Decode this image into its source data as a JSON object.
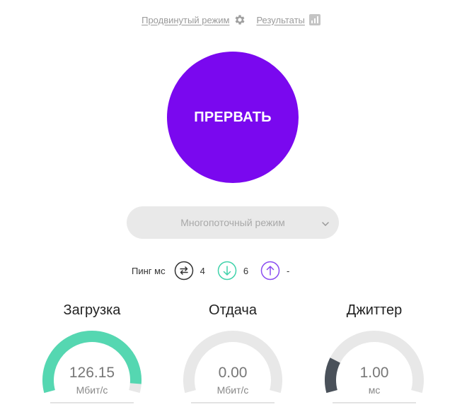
{
  "top_links": {
    "advanced_mode": "Продвинутый режим",
    "results": "Результаты"
  },
  "main_button": {
    "label": "ПРЕРВАТЬ",
    "color": "#7a08ef"
  },
  "mode_select": {
    "selected": "Многопоточный режим"
  },
  "ping": {
    "label": "Пинг мс",
    "items": [
      {
        "icon": "swap-arrows-icon",
        "value": "4",
        "color": "#333333"
      },
      {
        "icon": "arrow-down-circle-icon",
        "value": "6",
        "color": "#3fd2aa"
      },
      {
        "icon": "arrow-up-circle-icon",
        "value": "-",
        "color": "#8a4cf0"
      }
    ]
  },
  "gauges": [
    {
      "title": "Загрузка",
      "value": "126.15",
      "unit": "Мбит/с",
      "fill_fraction": 0.95,
      "color": "#55d7b1"
    },
    {
      "title": "Отдача",
      "value": "0.00",
      "unit": "Мбит/с",
      "fill_fraction": 0.0,
      "color": "#55d7b1"
    },
    {
      "title": "Джиттер",
      "value": "1.00",
      "unit": "мс",
      "fill_fraction": 0.2,
      "color": "#4a515a"
    }
  ],
  "colors": {
    "track": "#e8e8e8",
    "muted_text": "#9a9a9a"
  }
}
